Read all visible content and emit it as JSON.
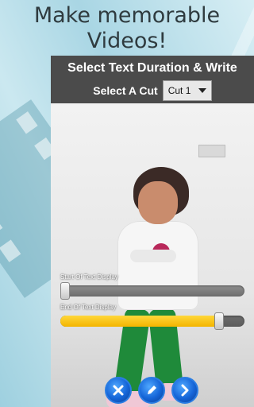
{
  "headline": {
    "line1": "Make memorable",
    "line2": "Videos!"
  },
  "panel": {
    "title": "Select Text Duration & Write",
    "cut_label": "Select A Cut",
    "cut_selected": "Cut 1"
  },
  "sliders": [
    {
      "label": "Start Of Text Display",
      "value_percent": 0
    },
    {
      "label": "End Of Text Display",
      "value_percent": 88
    }
  ],
  "buttons": [
    {
      "name": "cancel",
      "icon": "close-icon"
    },
    {
      "name": "edit",
      "icon": "pencil-icon"
    },
    {
      "name": "next",
      "icon": "chevron-right-icon"
    }
  ],
  "colors": {
    "accent_yellow": "#f3b400",
    "button_blue": "#1565d8",
    "panel_dark": "#3e3e3e"
  }
}
